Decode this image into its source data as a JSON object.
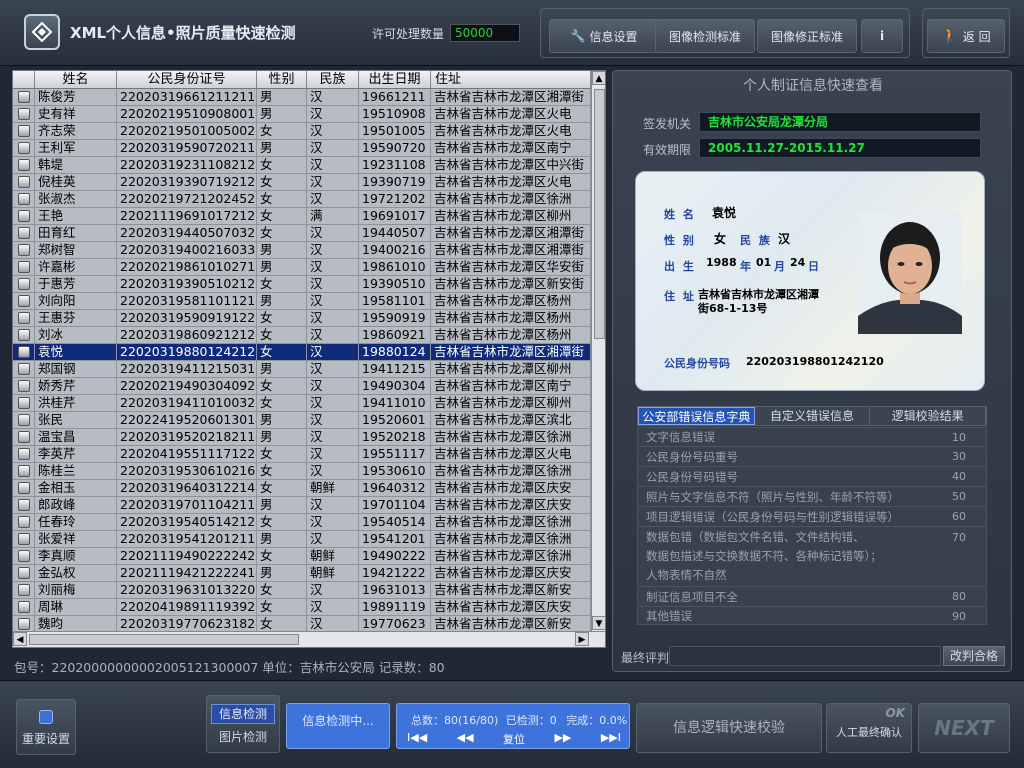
{
  "app": {
    "title": "XML个人信息•照片质量快速检测"
  },
  "license": {
    "label": "许可处理数量",
    "value": "50000"
  },
  "toolbar": {
    "info_settings": "信息设置",
    "image_standard": "图像检测标准",
    "correction_standard": "图像修正标准",
    "info_button": "i",
    "back": "返 回"
  },
  "table": {
    "columns": [
      "姓名",
      "公民身份证号",
      "性别",
      "民族",
      "出生日期",
      "住址"
    ],
    "rows": [
      {
        "name": "陈俊芳",
        "id": "220203196612112117",
        "sex": "男",
        "eth": "汉",
        "dob": "19661211",
        "addr": "吉林省吉林市龙潭区湘潭街"
      },
      {
        "name": "史有祥",
        "id": "220202195109080014",
        "sex": "男",
        "eth": "汉",
        "dob": "19510908",
        "addr": "吉林省吉林市龙潭区火电"
      },
      {
        "name": "齐志荣",
        "id": "220202195010050026",
        "sex": "女",
        "eth": "汉",
        "dob": "19501005",
        "addr": "吉林省吉林市龙潭区火电"
      },
      {
        "name": "王利军",
        "id": "220203195907202115",
        "sex": "男",
        "eth": "汉",
        "dob": "19590720",
        "addr": "吉林省吉林市龙潭区南宁"
      },
      {
        "name": "韩堤",
        "id": "220203192311082120",
        "sex": "女",
        "eth": "汉",
        "dob": "19231108",
        "addr": "吉林省吉林市龙潭区中兴街"
      },
      {
        "name": "倪桂英",
        "id": "220203193907192122",
        "sex": "女",
        "eth": "汉",
        "dob": "19390719",
        "addr": "吉林省吉林市龙潭区火电"
      },
      {
        "name": "张淑杰",
        "id": "220202197212024520X",
        "sex": "女",
        "eth": "汉",
        "dob": "19721202",
        "addr": "吉林省吉林市龙潭区徐洲"
      },
      {
        "name": "王艳",
        "id": "220211196910172126",
        "sex": "女",
        "eth": "满",
        "dob": "19691017",
        "addr": "吉林省吉林市龙潭区柳州"
      },
      {
        "name": "田育红",
        "id": "220203194405070322",
        "sex": "女",
        "eth": "汉",
        "dob": "19440507",
        "addr": "吉林省吉林市龙潭区湘潭街"
      },
      {
        "name": "郑树智",
        "id": "220203194002160331",
        "sex": "男",
        "eth": "汉",
        "dob": "19400216",
        "addr": "吉林省吉林市龙潭区湘潭街"
      },
      {
        "name": "许嘉彬",
        "id": "220202198610102719",
        "sex": "男",
        "eth": "汉",
        "dob": "19861010",
        "addr": "吉林省吉林市龙潭区华安街"
      },
      {
        "name": "于惠芳",
        "id": "22020319390510212X",
        "sex": "女",
        "eth": "汉",
        "dob": "19390510",
        "addr": "吉林省吉林市龙潭区新安街"
      },
      {
        "name": "刘向阳",
        "id": "220203195811011218",
        "sex": "男",
        "eth": "汉",
        "dob": "19581101",
        "addr": "吉林省吉林市龙潭区杨州"
      },
      {
        "name": "王惠芬",
        "id": "220203195909191229",
        "sex": "女",
        "eth": "汉",
        "dob": "19590919",
        "addr": "吉林省吉林市龙潭区杨州"
      },
      {
        "name": "刘冰",
        "id": "220203198609212124",
        "sex": "女",
        "eth": "汉",
        "dob": "19860921",
        "addr": "吉林省吉林市龙潭区杨州"
      },
      {
        "name": "袁悦",
        "id": "220203198801242120",
        "sex": "女",
        "eth": "汉",
        "dob": "19880124",
        "addr": "吉林省吉林市龙潭区湘潭街",
        "selected": true
      },
      {
        "name": "郑国钢",
        "id": "220203194112150310",
        "sex": "男",
        "eth": "汉",
        "dob": "19411215",
        "addr": "吉林省吉林市龙潭区柳州"
      },
      {
        "name": "娇秀芹",
        "id": "220202194903040920",
        "sex": "女",
        "eth": "汉",
        "dob": "19490304",
        "addr": "吉林省吉林市龙潭区南宁"
      },
      {
        "name": "洪桂芹",
        "id": "220203194110100328",
        "sex": "女",
        "eth": "汉",
        "dob": "19411010",
        "addr": "吉林省吉林市龙潭区柳州"
      },
      {
        "name": "张民",
        "id": "220224195206013014",
        "sex": "男",
        "eth": "汉",
        "dob": "19520601",
        "addr": "吉林省吉林市龙潭区滨北"
      },
      {
        "name": "温宝昌",
        "id": "220203195202182118",
        "sex": "男",
        "eth": "汉",
        "dob": "19520218",
        "addr": "吉林省吉林市龙潭区徐洲"
      },
      {
        "name": "李英芹",
        "id": "220204195511171224",
        "sex": "女",
        "eth": "汉",
        "dob": "19551117",
        "addr": "吉林省吉林市龙潭区火电"
      },
      {
        "name": "陈桂兰",
        "id": "22020319530610216X",
        "sex": "女",
        "eth": "汉",
        "dob": "19530610",
        "addr": "吉林省吉林市龙潭区徐洲"
      },
      {
        "name": "金相玉",
        "id": "220203196403122140",
        "sex": "女",
        "eth": "朝鲜",
        "dob": "19640312",
        "addr": "吉林省吉林市龙潭区庆安"
      },
      {
        "name": "郎政峰",
        "id": "220203197011042111",
        "sex": "男",
        "eth": "汉",
        "dob": "19701104",
        "addr": "吉林省吉林市龙潭区庆安"
      },
      {
        "name": "任春玲",
        "id": "220203195405142124",
        "sex": "女",
        "eth": "汉",
        "dob": "19540514",
        "addr": "吉林省吉林市龙潭区徐洲"
      },
      {
        "name": "张爱祥",
        "id": "220203195412012117",
        "sex": "男",
        "eth": "汉",
        "dob": "19541201",
        "addr": "吉林省吉林市龙潭区徐洲"
      },
      {
        "name": "李真顺",
        "id": "22021119490222242X",
        "sex": "女",
        "eth": "朝鲜",
        "dob": "19490222",
        "addr": "吉林省吉林市龙潭区徐洲"
      },
      {
        "name": "金弘权",
        "id": "220211194212222414",
        "sex": "男",
        "eth": "朝鲜",
        "dob": "19421222",
        "addr": "吉林省吉林市龙潭区庆安"
      },
      {
        "name": "刘丽梅",
        "id": "220203196310132200",
        "sex": "女",
        "eth": "汉",
        "dob": "19631013",
        "addr": "吉林省吉林市龙潭区新安"
      },
      {
        "name": "周琳",
        "id": "220204198911193928",
        "sex": "女",
        "eth": "汉",
        "dob": "19891119",
        "addr": "吉林省吉林市龙潭区庆安"
      },
      {
        "name": "魏昀",
        "id": "220203197706231824",
        "sex": "女",
        "eth": "汉",
        "dob": "19770623",
        "addr": "吉林省吉林市龙潭区新安"
      }
    ]
  },
  "package_info": "包号：22020000000002005121300007 单位：吉林市公安局 记录数：80",
  "panel": {
    "title": "个人制证信息快速查看",
    "issuer_label": "签发机关",
    "issuer_value": "吉林市公安局龙潭分局",
    "validity_label": "有效期限",
    "validity_value": "2005.11.27-2015.11.27"
  },
  "card": {
    "name_label": "姓 名",
    "name": "袁悦",
    "sex_label": "性 别",
    "sex": "女",
    "ethnic_label": "民 族",
    "ethnic": "汉",
    "birth_label": "出 生",
    "birth_year": "1988",
    "year_unit": "年",
    "birth_month": "01",
    "month_unit": "月",
    "birth_day": "24",
    "day_unit": "日",
    "addr_label": "住 址",
    "addr_line1": "吉林省吉林市龙潭区湘潭",
    "addr_line2": "街68-1-13号",
    "id_label": "公民身份号码",
    "id_number": "220203198801242120"
  },
  "tabs": [
    "公安部错误信息字典",
    "自定义错误信息",
    "逻辑校验结果"
  ],
  "errors": [
    {
      "label": "文字信息错误",
      "score": "10"
    },
    {
      "label": "公民身份号码重号",
      "score": "30"
    },
    {
      "label": "公民身份号码错号",
      "score": "40"
    },
    {
      "label": "照片与文字信息不符（照片与性别、年龄不符等）",
      "score": "50"
    },
    {
      "label": "项目逻辑错误（公民身份号码与性别逻辑错误等）",
      "score": "60"
    },
    {
      "label": "数据包错（数据包文件名错、文件结构错、",
      "label2": "数据包描述与交换数据不符、各种标记错等）；",
      "label3": "人物表情不自然",
      "score": "70"
    },
    {
      "label": "制证信息项目不全",
      "score": "80"
    },
    {
      "label": "其他错误",
      "score": "90"
    }
  ],
  "final": {
    "label": "最终评判",
    "button": "改判合格"
  },
  "bottom": {
    "important_settings": "重要设置",
    "info_check": "信息检测",
    "photo_check": "图片检测",
    "checking_status": "信息检测中...",
    "total": "总数：80(16/80)",
    "checked": "已检测：0",
    "done": "完成：0.0%",
    "nav_first": "I◀◀",
    "nav_prev": "◀◀",
    "nav_reset": "复位",
    "nav_next": "▶▶",
    "nav_last": "▶▶I",
    "logic_check": "信息逻辑快速校验",
    "ok_text": "OK",
    "manual_confirm": "人工最终确认",
    "next": "NEXT"
  },
  "icons": {
    "logo": "logo-icon",
    "wrench": "wrench-icon",
    "walk": "walking-person-icon",
    "database": "database-icon"
  }
}
